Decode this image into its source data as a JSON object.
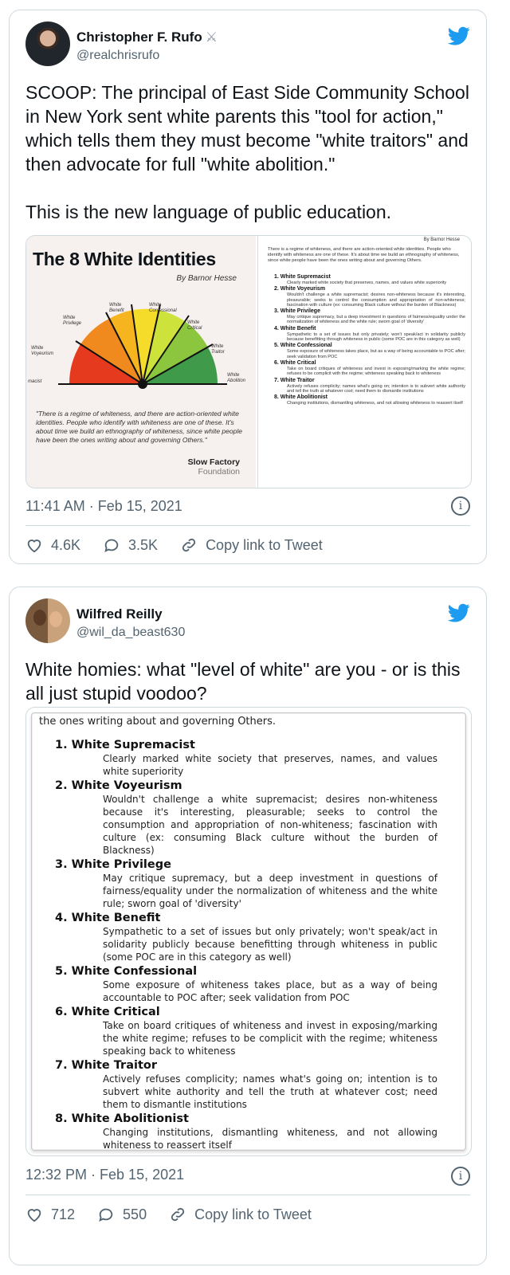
{
  "tweets": [
    {
      "author": {
        "name": "Christopher F. Rufo",
        "handle": "@realchrisrufo",
        "name_emoji": "⚔"
      },
      "text": {
        "p1": "SCOOP: The principal of East Side Community School in New York sent white parents this \"tool for action,\" which tells them they must become \"white traitors\" and then advocate for full \"white abolition.\"",
        "p2": "This is the new language of public education."
      },
      "image": {
        "title": "The 8 White Identities",
        "byline": "By Barnor Hesse",
        "gauge_labels": [
          "White Voyeurism",
          "White Privilege",
          "White Benefit",
          "White Confessional",
          "White Critical",
          "White Traitor",
          "White Abolition",
          "macist"
        ],
        "quote": "\"There is a regime of whiteness, and there are action-oriented white identities. People who identify with whiteness are one of these. It's about time we build an ethnography of whiteness, since white people have been the ones writing about and governing Others.\"",
        "footer_1": "Slow Factory",
        "footer_2": "Foundation",
        "right_byline": "By Barnor Hesse",
        "right_intro": "There is a regime of whiteness, and there are action-oriented white identities. People who identify with whiteness are one of these. It's about time we build an ethnography of whiteness, since white people have been the ones writing about and governing Others.",
        "items": [
          {
            "head": "1. White Supremacist",
            "desc": "Clearly marked white society that preserves, names, and values white superiority"
          },
          {
            "head": "2. White Voyeurism",
            "desc": "Wouldn't challenge a white supremacist; desires non-whiteness because it's interesting, pleasurable; seeks to control the consumption and appropriation of non-whiteness; fascination with culture (ex: consuming Black culture without the burden of Blackness)"
          },
          {
            "head": "3. White Privilege",
            "desc": "May critique supremacy, but a deep investment in questions of fairness/equality under the normalization of whiteness and the white rule; sworn goal of 'diversity'"
          },
          {
            "head": "4. White Benefit",
            "desc": "Sympathetic to a set of issues but only privately; won't speak/act in solidarity publicly because benefitting through whiteness in public (some POC are in this category as well)"
          },
          {
            "head": "5. White Confessional",
            "desc": "Some exposure of whiteness takes place, but as a way of being accountable to POC after; seek validation from POC"
          },
          {
            "head": "6. White Critical",
            "desc": "Take on board critiques of whiteness and invest in exposing/marking the white regime; refuses to be complicit with the regime; whiteness speaking back to whiteness"
          },
          {
            "head": "7. White Traitor",
            "desc": "Actively refuses complicity; names what's going on; intention is to subvert white authority and tell the truth at whatever cost; need them to dismantle institutions"
          },
          {
            "head": "8. White Abolitionist",
            "desc": "Changing institutions, dismantling whiteness, and not allowing whiteness to reassert itself"
          }
        ]
      },
      "timestamp": "11:41 AM · Feb 15, 2021",
      "likes": "4.6K",
      "replies": "3.5K",
      "copy_link": "Copy link to Tweet"
    },
    {
      "author": {
        "name": "Wilfred Reilly",
        "handle": "@wil_da_beast630"
      },
      "text": {
        "p1": "White homies: what \"level of white\" are you - or is this all just stupid voodoo?"
      },
      "image": {
        "intro": "the ones writing about and governing Others."
      },
      "timestamp": "12:32 PM · Feb 15, 2021",
      "likes": "712",
      "replies": "550",
      "copy_link": "Copy link to Tweet"
    }
  ],
  "colors": {
    "twitter_blue": "#1d9bf0",
    "text": "#0f1419",
    "muted": "#536471",
    "border": "#cfd9de"
  },
  "icons": [
    "twitter-bird-icon",
    "info-icon",
    "heart-icon",
    "reply-icon",
    "link-icon"
  ]
}
